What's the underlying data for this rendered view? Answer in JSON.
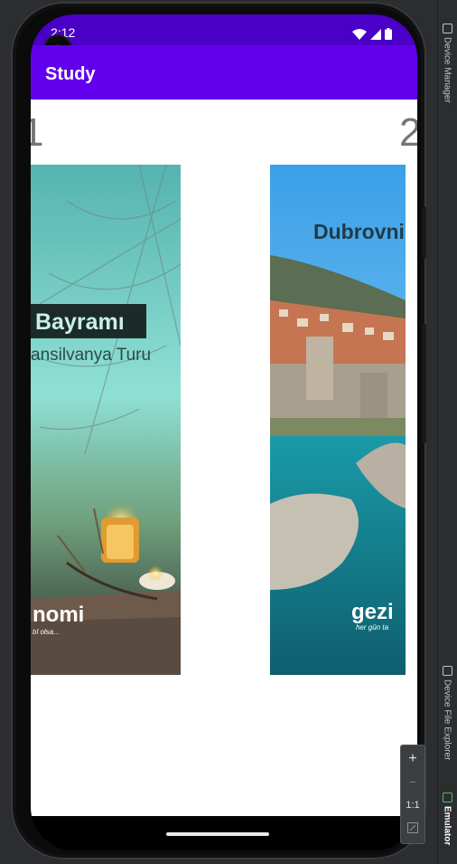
{
  "status_bar": {
    "time": "2:12"
  },
  "app_bar": {
    "title": "Study"
  },
  "pager": {
    "pages": [
      {
        "number": "1",
        "headline": "Bayramı",
        "subtitle": "ansilvanya Turu",
        "brand": "nomi",
        "brand_tagline": "tıl olsa..."
      },
      {
        "number": "2",
        "headline": "Dubrovni",
        "brand": "gezi",
        "brand_tagline": "her gün ta"
      }
    ]
  },
  "ide_panel": {
    "tabs": [
      {
        "label": "Device Manager"
      },
      {
        "label": "Device File Explorer"
      },
      {
        "label": "Emulator"
      }
    ]
  },
  "zoom_controls": {
    "zoom_in": "+",
    "zoom_out": "−",
    "actual_size": "1:1"
  }
}
